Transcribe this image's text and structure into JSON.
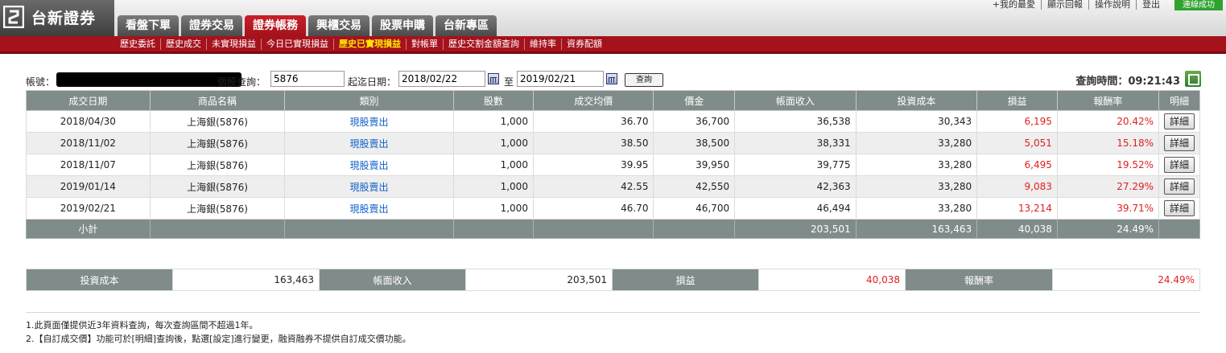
{
  "brand": {
    "logo_text": "台新證券"
  },
  "top_nav": [
    {
      "label": "看盤下單",
      "active": false
    },
    {
      "label": "證券交易",
      "active": false
    },
    {
      "label": "證券帳務",
      "active": true
    },
    {
      "label": "興櫃交易",
      "active": false
    },
    {
      "label": "股票申購",
      "active": false
    },
    {
      "label": "台新專區",
      "active": false
    }
  ],
  "top_links": [
    "+我的最愛",
    "顯示回報",
    "操作說明",
    "登出"
  ],
  "connection_status": "連線成功",
  "sub_nav": [
    {
      "label": "歷史委託",
      "active": false
    },
    {
      "label": "歷史成交",
      "active": false
    },
    {
      "label": "未實現損益",
      "active": false
    },
    {
      "label": "今日已實現損益",
      "active": false
    },
    {
      "label": "歷史已實現損益",
      "active": true
    },
    {
      "label": "對帳單",
      "active": false
    },
    {
      "label": "歷史交割金額查詢",
      "active": false
    },
    {
      "label": "維持率",
      "active": false
    },
    {
      "label": "資券配額",
      "active": false
    }
  ],
  "query": {
    "account_label": "帳號：",
    "stock_label": "個股查詢：",
    "stock_value": "5876",
    "date_label": "起迄日期：",
    "start_date": "2018/02/22",
    "to_label": "至",
    "end_date": "2019/02/21",
    "query_button": "查詢",
    "query_time": "查詢時間：09:21:43"
  },
  "table": {
    "headers": [
      "成交日期",
      "商品名稱",
      "類別",
      "股數",
      "成交均價",
      "價金",
      "帳面收入",
      "投資成本",
      "損益",
      "報酬率",
      "明細"
    ],
    "rows": [
      {
        "date": "2018/04/30",
        "product": "上海銀(5876)",
        "type": "現股賣出",
        "shares": "1,000",
        "avg_price": "36.70",
        "amount": "36,700",
        "income": "36,538",
        "cost": "30,343",
        "pnl": "6,195",
        "rate": "20.42%",
        "detail": "詳細"
      },
      {
        "date": "2018/11/02",
        "product": "上海銀(5876)",
        "type": "現股賣出",
        "shares": "1,000",
        "avg_price": "38.50",
        "amount": "38,500",
        "income": "38,331",
        "cost": "33,280",
        "pnl": "5,051",
        "rate": "15.18%",
        "detail": "詳細"
      },
      {
        "date": "2018/11/07",
        "product": "上海銀(5876)",
        "type": "現股賣出",
        "shares": "1,000",
        "avg_price": "39.95",
        "amount": "39,950",
        "income": "39,775",
        "cost": "33,280",
        "pnl": "6,495",
        "rate": "19.52%",
        "detail": "詳細"
      },
      {
        "date": "2019/01/14",
        "product": "上海銀(5876)",
        "type": "現股賣出",
        "shares": "1,000",
        "avg_price": "42.55",
        "amount": "42,550",
        "income": "42,363",
        "cost": "33,280",
        "pnl": "9,083",
        "rate": "27.29%",
        "detail": "詳細"
      },
      {
        "date": "2019/02/21",
        "product": "上海銀(5876)",
        "type": "現股賣出",
        "shares": "1,000",
        "avg_price": "46.70",
        "amount": "46,700",
        "income": "46,494",
        "cost": "33,280",
        "pnl": "13,214",
        "rate": "39.71%",
        "detail": "詳細"
      }
    ],
    "subtotal": {
      "label": "小計",
      "income": "203,501",
      "cost": "163,463",
      "pnl": "40,038",
      "rate": "24.49%"
    }
  },
  "summary": {
    "cost_label": "投資成本",
    "cost_value": "163,463",
    "income_label": "帳面收入",
    "income_value": "203,501",
    "pnl_label": "損益",
    "pnl_value": "40,038",
    "rate_label": "報酬率",
    "rate_value": "24.49%"
  },
  "notes": [
    "1.此頁面僅提供近3年資料查詢，每次查詢區間不超過1年。",
    "2.【自訂成交價】功能可於[明細]查詢後，點選[設定]進行變更，融資融券不提供自訂成交價功能。"
  ],
  "colors": {
    "brand_red": "#a5121c",
    "header_gray": "#7f8c8a",
    "loss_profit_red": "#e02020",
    "link_blue": "#1060c8",
    "status_green": "#2fa32f"
  }
}
